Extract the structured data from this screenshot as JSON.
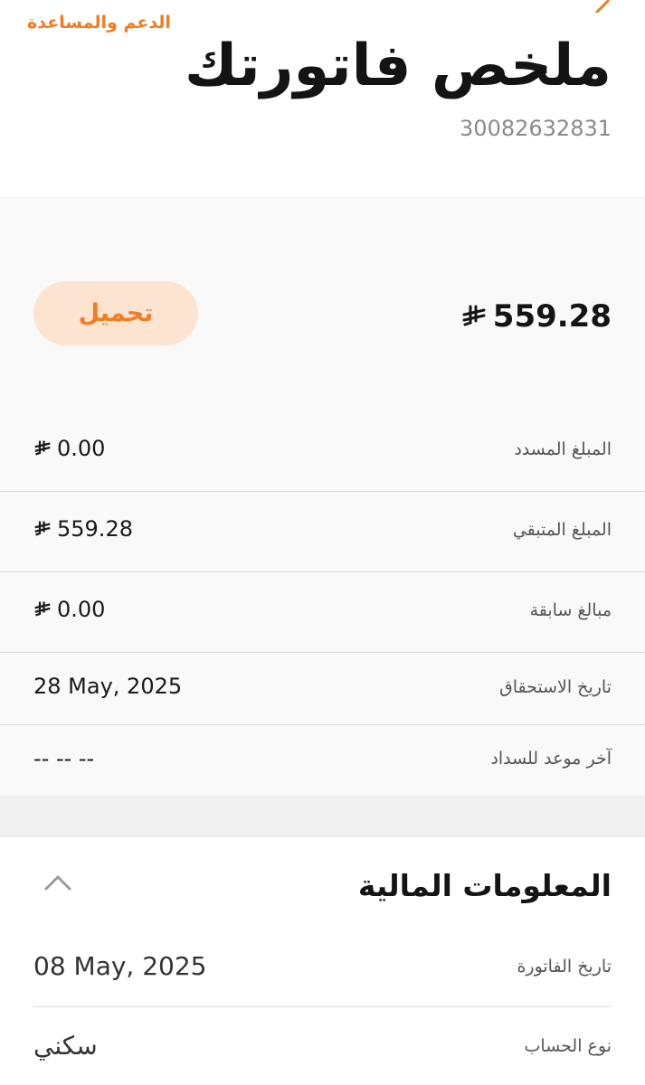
{
  "header": {
    "support_link": "الدعم والمساعدة",
    "title": "ملخص فاتورتك",
    "invoice_number": "30082632831"
  },
  "summary": {
    "total_amount": "559.28",
    "download_label": "تحميل",
    "rows": [
      {
        "label": "المبلغ المسدد",
        "value": "0.00",
        "currency": true
      },
      {
        "label": "المبلغ المتبقي",
        "value": "559.28",
        "currency": true
      },
      {
        "label": "مبالغ سابقة",
        "value": "0.00",
        "currency": true
      },
      {
        "label": "تاريخ الاستحقاق",
        "value": "28 May, 2025",
        "currency": false
      },
      {
        "label": "آخر موعد للسداد",
        "value": "-- -- --",
        "currency": false
      }
    ]
  },
  "financial_info": {
    "title": "المعلومات المالية",
    "rows": [
      {
        "label": "تاريخ الفاتورة",
        "value": "08 May, 2025"
      },
      {
        "label": "نوع الحساب",
        "value": "سكني"
      }
    ]
  },
  "colors": {
    "accent": "#f47b20",
    "button_bg": "#fde4d1",
    "card_bg": "#f9f9f9"
  },
  "icons": {
    "currency": "saudi-riyal-icon",
    "collapse": "chevron-up-icon",
    "corner": "arrow-icon"
  }
}
